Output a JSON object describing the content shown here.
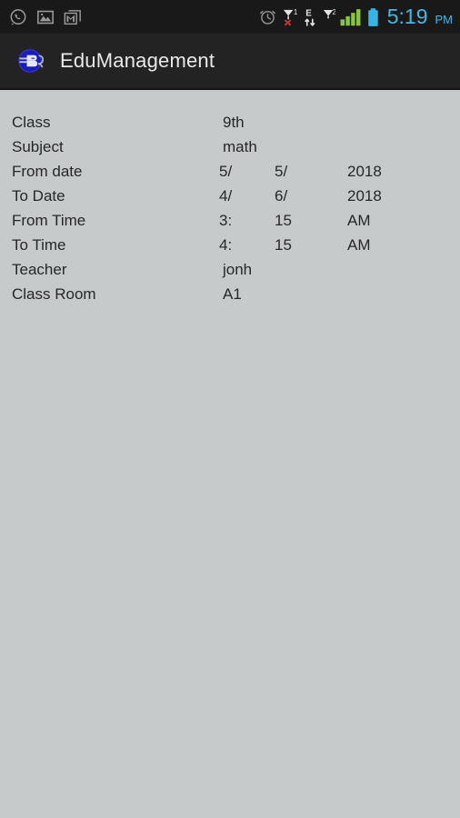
{
  "status_bar": {
    "icons_left": [
      {
        "name": "whatsapp-icon",
        "label": "WhatsApp"
      },
      {
        "name": "gallery-icon",
        "label": "Gallery"
      },
      {
        "name": "gmail-icon",
        "label": "Gmail"
      }
    ],
    "icons_right": [
      {
        "name": "alarm-clock-icon",
        "label": "Alarm set"
      },
      {
        "name": "sim1-no-signal-icon",
        "label": "SIM 1 no service"
      },
      {
        "name": "edge-data-icon",
        "label": "E"
      },
      {
        "name": "sim2-signal-icon",
        "label": "SIM 2 signal"
      },
      {
        "name": "battery-icon",
        "label": "Battery full"
      }
    ],
    "time": "5:19",
    "ampm": "PM",
    "time_color": "#45b8e0",
    "signal_color": "#8cc63f",
    "battery_color": "#33b5e5",
    "sim1_badge": "1",
    "sim2_badge": "2",
    "edge_label": "E",
    "background": "#191919"
  },
  "action_bar": {
    "logo_name": "edumanagement-logo",
    "logo_text": "BS",
    "logo_color": "#1b1bbf",
    "title": "EduManagement",
    "background": "#232323",
    "title_color": "#e9e9e9"
  },
  "content": {
    "background": "#c6cacb",
    "text_color": "#272727",
    "rows": [
      {
        "label": "Class",
        "v1": "9th",
        "v2": "",
        "v3": "",
        "single": true
      },
      {
        "label": "Subject",
        "v1": "math",
        "v2": "",
        "v3": "",
        "single": true
      },
      {
        "label": "From date",
        "v1": "5/",
        "v2": "5/",
        "v3": "2018",
        "single": false
      },
      {
        "label": "To Date",
        "v1": "4/",
        "v2": "6/",
        "v3": "2018",
        "single": false
      },
      {
        "label": "From Time",
        "v1": "3:",
        "v2": "15",
        "v3": "AM",
        "single": false
      },
      {
        "label": "To Time",
        "v1": "4:",
        "v2": "15",
        "v3": "AM",
        "single": false
      },
      {
        "label": "Teacher",
        "v1": "jonh",
        "v2": "",
        "v3": "",
        "single": true
      },
      {
        "label": "Class Room",
        "v1": "A1",
        "v2": "",
        "v3": "",
        "single": true
      }
    ]
  }
}
